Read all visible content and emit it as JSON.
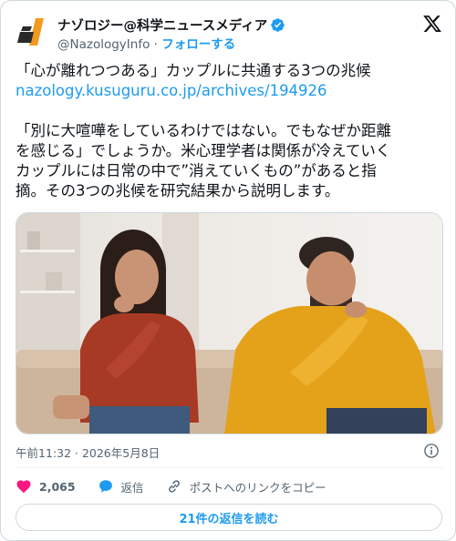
{
  "author": {
    "display_name": "ナゾロジー@科学ニュースメディア",
    "handle": "@NazologyInfo",
    "separator": "·",
    "follow_label": "フォローする",
    "verified_icon": "verified-badge-icon",
    "avatar_icon": "nazology-logo"
  },
  "post": {
    "headline": "「心が離れつつある」カップルに共通する3つの兆候",
    "link": "nazology.kusuguru.co.jp/archives/194926",
    "body_lines": [
      "「別に大喧嘩をしているわけではない。でもなぜか距離",
      "を感じる」でしょうか。米心理学者は関係が冷えていく",
      "カップルには日常の中で”消えていくもの”があると指",
      "摘。その3つの兆候を研究結果から説明します。"
    ]
  },
  "meta": {
    "timestamp": "午前11:32 · 2026年5月8日",
    "info_icon": "info-icon"
  },
  "actions": {
    "like_count": "2,065",
    "reply_label": "返信",
    "copy_link_label": "ポストへのリンクをコピー"
  },
  "replies_button": "21件の返信を読む",
  "colors": {
    "accent": "#1d9bf0",
    "like": "#f91880",
    "text": "#0f1419",
    "muted": "#536471"
  }
}
